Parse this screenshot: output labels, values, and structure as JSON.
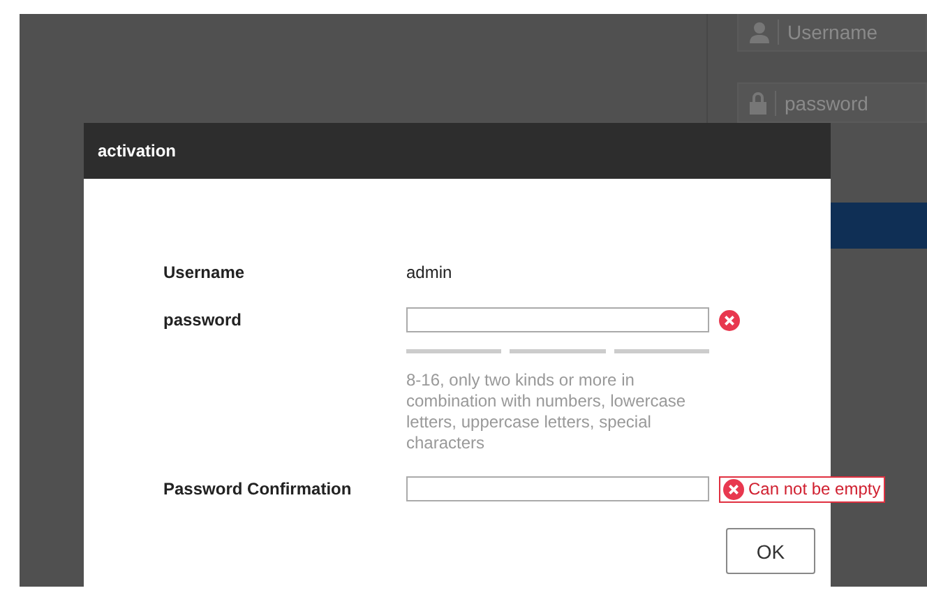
{
  "background_login": {
    "fields": [
      {
        "kind": "user",
        "placeholder": "Username"
      },
      {
        "kind": "lock",
        "placeholder": "password"
      }
    ]
  },
  "dialog": {
    "title": "activation",
    "username": {
      "label": "Username",
      "value": "admin"
    },
    "password": {
      "label": "password",
      "error": true,
      "hint": "8-16, only two kinds or more in combination with numbers, lowercase letters, uppercase letters, special characters"
    },
    "confirmation": {
      "label": "Password Confirmation",
      "error": true,
      "error_message": "Can not be empty"
    },
    "buttons": [
      "OK"
    ]
  }
}
